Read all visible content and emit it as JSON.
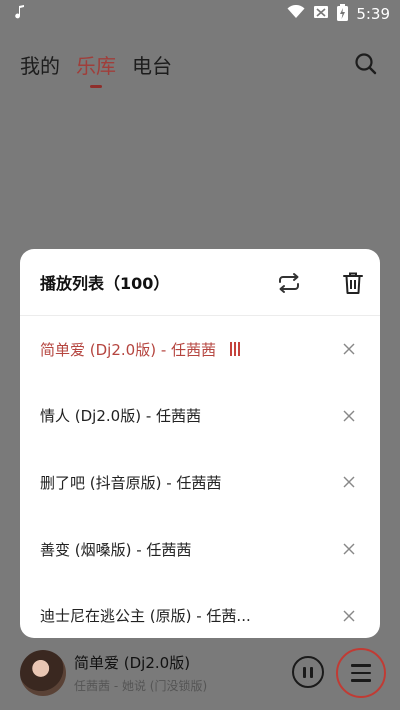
{
  "status_bar": {
    "time": "5:39",
    "icons": [
      "music-note-icon",
      "wifi-icon",
      "no-sim-icon",
      "battery-charging-icon"
    ]
  },
  "tabs": [
    {
      "label": "我的",
      "active": false
    },
    {
      "label": "乐库",
      "active": true
    },
    {
      "label": "电台",
      "active": false
    }
  ],
  "playlist": {
    "title": "播放列表（100）",
    "songs": [
      {
        "title": "简单爱 (Dj2.0版) - 任茜茜",
        "playing": true
      },
      {
        "title": "情人 (Dj2.0版) - 任茜茜",
        "playing": false
      },
      {
        "title": "删了吧 (抖音原版) - 任茜茜",
        "playing": false
      },
      {
        "title": "善变 (烟嗓版) - 任茜茜",
        "playing": false
      },
      {
        "title": "迪士尼在逃公主 (原版) - 任茜...",
        "playing": false
      }
    ]
  },
  "now_playing": {
    "title": "简单爱 (Dj2.0版)",
    "subtitle": "任茜茜 - 她说 (门没锁版)"
  },
  "colors": {
    "accent": "#a03e3a",
    "overlay": "#7a7a7a",
    "playing_text": "#b5453f"
  }
}
